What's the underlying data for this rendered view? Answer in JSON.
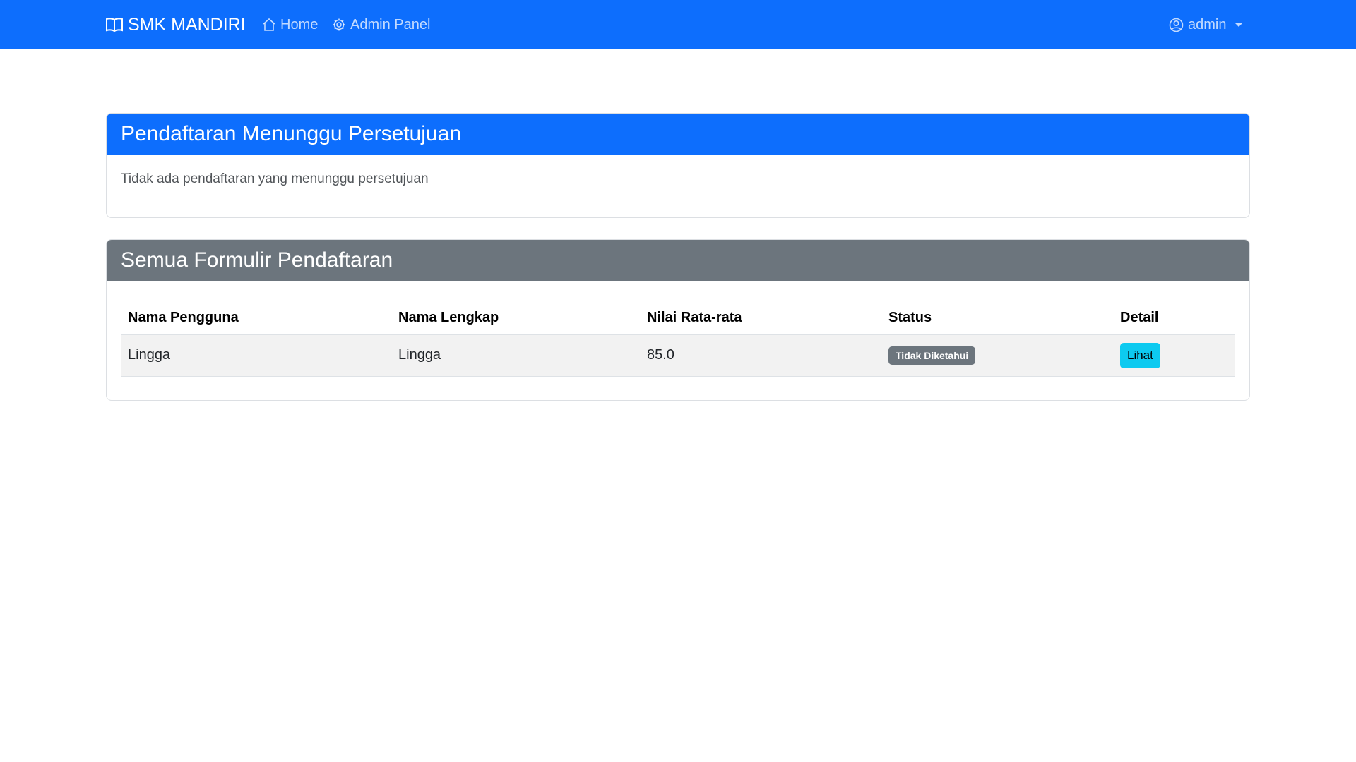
{
  "navbar": {
    "brand": "SMK MANDIRI",
    "brand_icon": "book-icon",
    "links": [
      {
        "label": "Home",
        "icon": "house-icon"
      },
      {
        "label": "Admin Panel",
        "icon": "gear-icon"
      }
    ],
    "user": {
      "label": "admin",
      "icon": "person-circle-icon"
    },
    "color": "#0d6efd"
  },
  "pending_card": {
    "title": "Pendaftaran Menunggu Persetujuan",
    "empty_text": "Tidak ada pendaftaran yang menunggu persetujuan",
    "header_color": "#0d6efd"
  },
  "all_forms_card": {
    "title": "Semua Formulir Pendaftaran",
    "header_color": "#6c757d",
    "columns": [
      "Nama Pengguna",
      "Nama Lengkap",
      "Nilai Rata-rata",
      "Status",
      "Detail"
    ],
    "rows": [
      {
        "username": "Lingga",
        "full_name": "Lingga",
        "average_score": "85.0",
        "status": "Tidak Diketahui",
        "status_color": "#6c757d",
        "action": "Lihat",
        "action_color": "#0dcaf0"
      }
    ]
  }
}
